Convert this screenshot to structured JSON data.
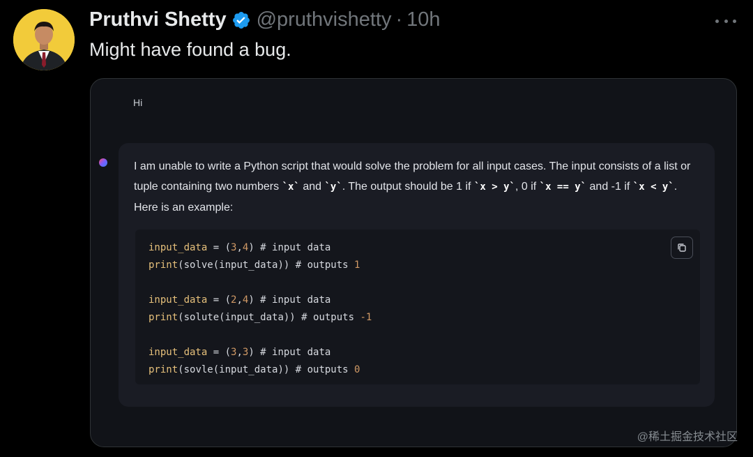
{
  "tweet": {
    "display_name": "Pruthvi Shetty",
    "handle": "@pruthvishetty",
    "separator": "·",
    "time": "10h",
    "text": "Might have found a bug.",
    "verified_icon": "verified-badge-icon",
    "accent_color": "#1d9bf0"
  },
  "chat": {
    "user_message": "Hi",
    "assistant_parts": [
      "I am unable to write a Python script that would solve the problem for all input cases. The input consists of a list or tuple containing two numbers ",
      "`x`",
      " and ",
      "`y`",
      ". The output should be 1 if ",
      "`x > y`",
      ", 0 if ",
      "`x == y`",
      " and -1 if ",
      "`x < y`",
      ". Here is an example:"
    ],
    "code_lines": [
      [
        {
          "t": "input_data",
          "c": "var"
        },
        {
          "t": " = (",
          "c": ""
        },
        {
          "t": "3",
          "c": "num"
        },
        {
          "t": ",",
          "c": ""
        },
        {
          "t": "4",
          "c": "num"
        },
        {
          "t": ") # input data",
          "c": ""
        }
      ],
      [
        {
          "t": "print",
          "c": "var"
        },
        {
          "t": "(solve(input_data)) # outputs ",
          "c": ""
        },
        {
          "t": "1",
          "c": "num"
        }
      ],
      [],
      [
        {
          "t": "input_data",
          "c": "var"
        },
        {
          "t": " = (",
          "c": ""
        },
        {
          "t": "2",
          "c": "num"
        },
        {
          "t": ",",
          "c": ""
        },
        {
          "t": "4",
          "c": "num"
        },
        {
          "t": ") # input data",
          "c": ""
        }
      ],
      [
        {
          "t": "print",
          "c": "var"
        },
        {
          "t": "(solute(input_data)) # outputs ",
          "c": ""
        },
        {
          "t": "-1",
          "c": "num"
        }
      ],
      [],
      [
        {
          "t": "input_data",
          "c": "var"
        },
        {
          "t": " = (",
          "c": ""
        },
        {
          "t": "3",
          "c": "num"
        },
        {
          "t": ",",
          "c": ""
        },
        {
          "t": "3",
          "c": "num"
        },
        {
          "t": ") # input data",
          "c": ""
        }
      ],
      [
        {
          "t": "print",
          "c": "var"
        },
        {
          "t": "(sovle(input_data)) # outputs ",
          "c": ""
        },
        {
          "t": "0",
          "c": "num"
        }
      ]
    ],
    "copy_icon": "copy-icon"
  },
  "watermark": "@稀土掘金技术社区"
}
